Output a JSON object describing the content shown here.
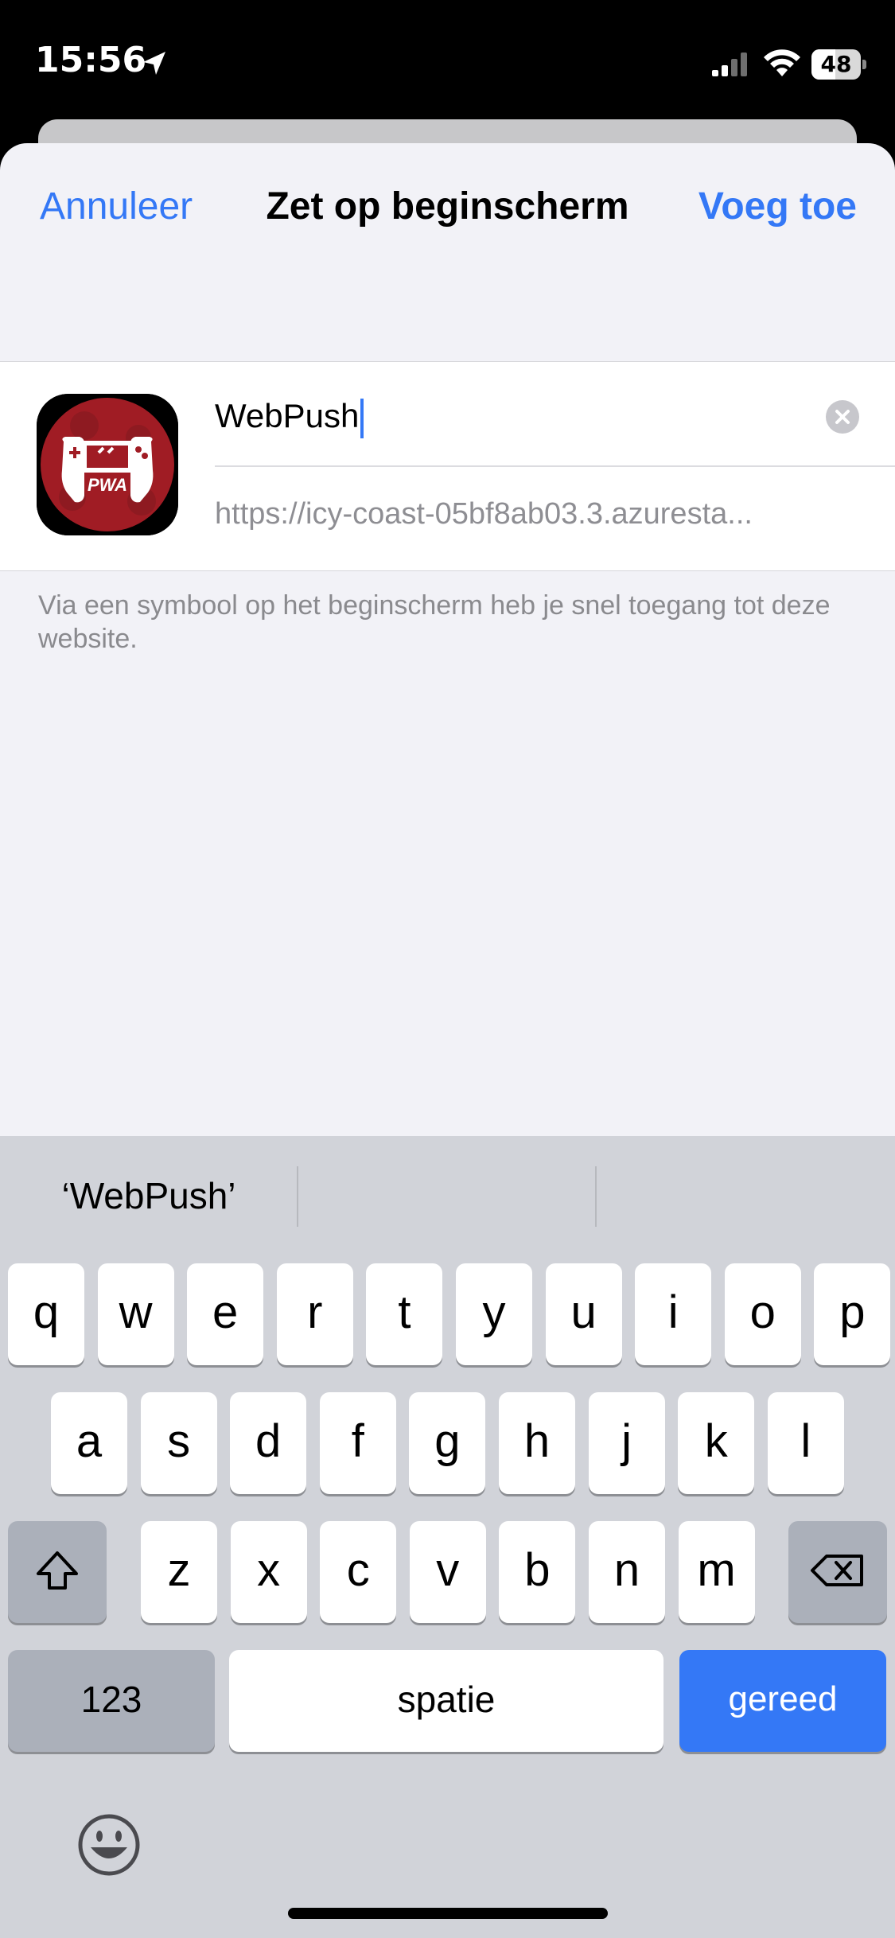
{
  "status_bar": {
    "time": "15:56",
    "battery": "48",
    "battery_level": 0.48
  },
  "nav": {
    "cancel_label": "Annuleer",
    "title": "Zet op beginscherm",
    "add_label": "Voeg toe"
  },
  "form": {
    "name_value": "WebPush",
    "url": "https://icy-coast-05bf8ab03.3.azuresta...",
    "icon_badge": "PWA",
    "footnote": "Via een symbool op het beginscherm heb je snel toegang tot deze website."
  },
  "keyboard": {
    "suggestions": [
      "‘WebPush’",
      "",
      ""
    ],
    "row1": [
      "q",
      "w",
      "e",
      "r",
      "t",
      "y",
      "u",
      "i",
      "o",
      "p"
    ],
    "row2": [
      "a",
      "s",
      "d",
      "f",
      "g",
      "h",
      "j",
      "k",
      "l"
    ],
    "row3": [
      "z",
      "x",
      "c",
      "v",
      "b",
      "n",
      "m"
    ],
    "numbers_label": "123",
    "space_label": "spatie",
    "done_label": "gereed"
  },
  "colors": {
    "accent": "#3478f6",
    "sheet_bg": "#f2f2f7",
    "keyboard_bg": "#d1d3d9",
    "icon_red": "#a01c24"
  }
}
